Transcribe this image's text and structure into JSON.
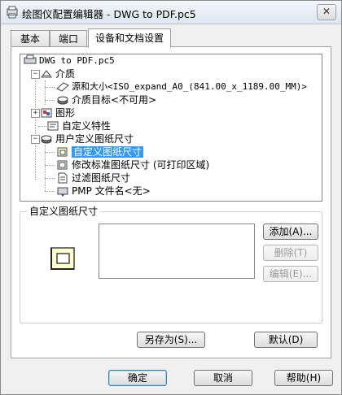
{
  "window": {
    "title": "绘图仪配置编辑器 - DWG to PDF.pc5",
    "close_glyph": "✕"
  },
  "tabs": [
    {
      "label": "基本"
    },
    {
      "label": "端口"
    },
    {
      "label": "设备和文档设置"
    }
  ],
  "tree": {
    "root": "DWG to PDF.pc5",
    "media": "介质",
    "source_size": "源和大小<ISO_expand_A0_(841.00_x_1189.00_MM)>",
    "media_dest": "介质目标<不可用>",
    "graphics": "图形",
    "custom_props": "自定义特性",
    "user_paper": "用户定义图纸尺寸",
    "custom_paper": "自定义图纸尺寸",
    "modify_std": "修改标准图纸尺寸 (可打印区域)",
    "filter_paper": "过滤图纸尺寸",
    "pmp_file": "PMP 文件名<无>"
  },
  "group": {
    "label": "自定义图纸尺寸",
    "add": "添加(A)...",
    "delete": "删除(T)",
    "edit": "编辑(E)..."
  },
  "footer": {
    "save_as": "另存为(S)...",
    "defaults": "默认(D)",
    "ok": "确定",
    "cancel": "取消",
    "help": "帮助(H)"
  },
  "colors": {
    "selection": "#3399ff",
    "window_bg": "#f0f0f0"
  }
}
